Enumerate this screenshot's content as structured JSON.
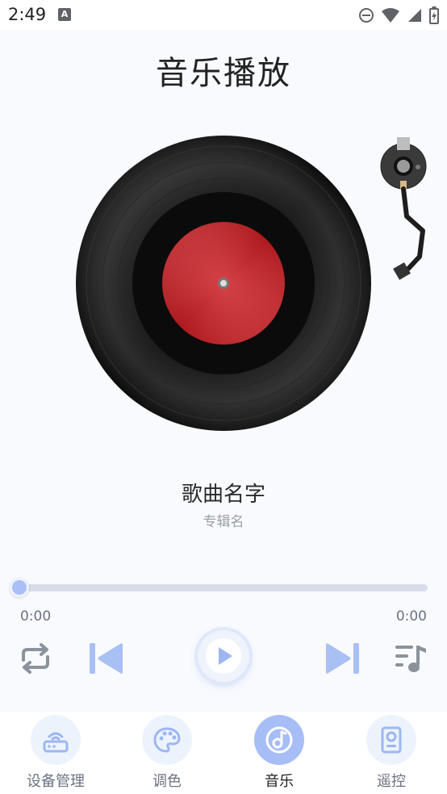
{
  "status_bar": {
    "time": "2:49",
    "notification_letter": "A"
  },
  "header": {
    "title": "音乐播放"
  },
  "player": {
    "song_title": "歌曲名字",
    "album_name": "专辑名",
    "progress_fraction": 0,
    "current_time": "0:00",
    "total_time": "0:00"
  },
  "icons": {
    "repeat": "repeat-icon",
    "previous": "skip-previous-icon",
    "play": "play-icon",
    "next": "skip-next-icon",
    "playlist": "playlist-icon"
  },
  "bottom_nav": {
    "items": [
      {
        "label": "设备管理",
        "icon": "router-icon",
        "active": false
      },
      {
        "label": "调色",
        "icon": "palette-icon",
        "active": false
      },
      {
        "label": "音乐",
        "icon": "music-note-icon",
        "active": true
      },
      {
        "label": "遥控",
        "icon": "remote-icon",
        "active": false
      }
    ]
  },
  "colors": {
    "accent": "#a7bdf6",
    "accent_light": "#edf3fd",
    "record_label": "#d8262b"
  }
}
